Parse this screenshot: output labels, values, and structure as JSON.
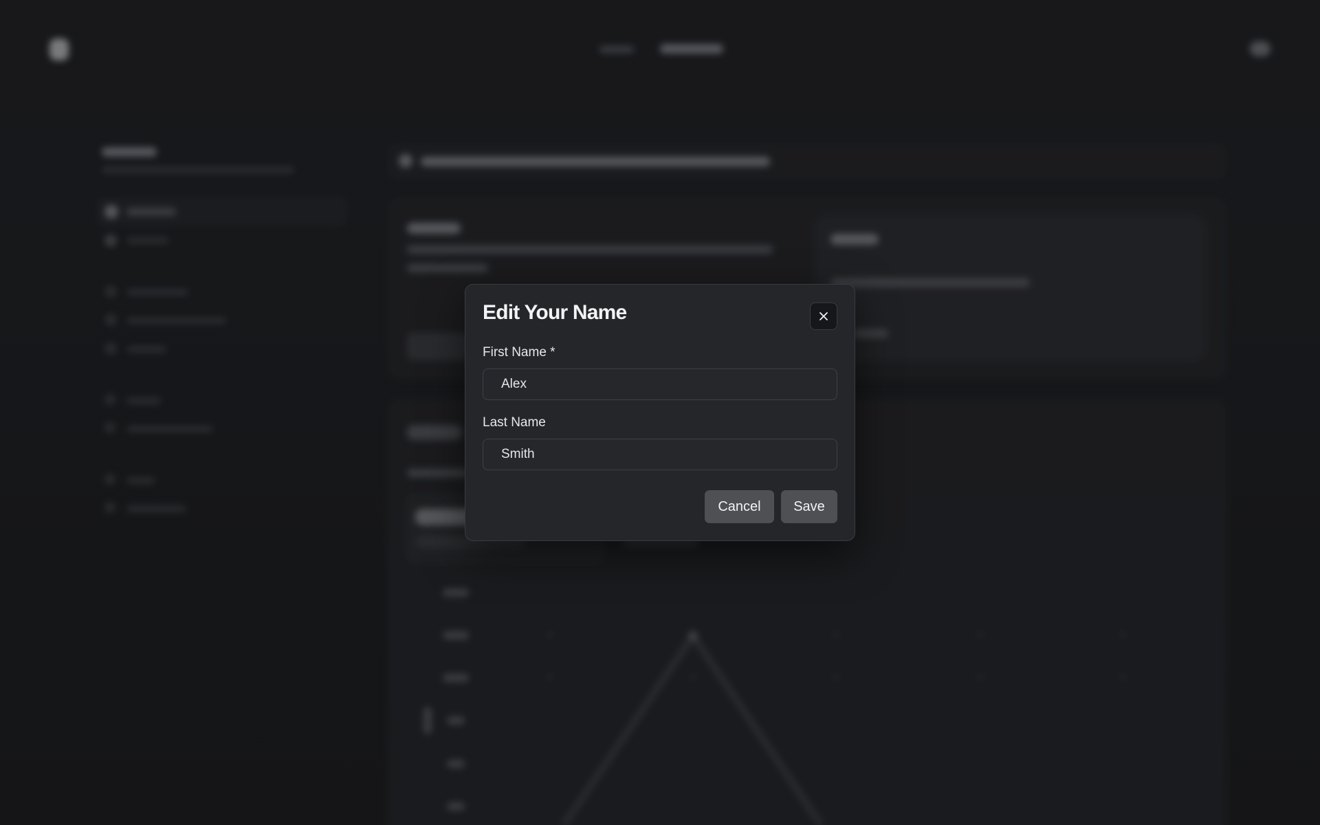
{
  "modal": {
    "title": "Edit Your Name",
    "close_icon": "close-icon",
    "first_name": {
      "label": "First Name *",
      "value": "Alex",
      "placeholder": ""
    },
    "last_name": {
      "label": "Last Name",
      "value": "Smith",
      "placeholder": ""
    },
    "buttons": {
      "cancel_label": "Cancel",
      "save_label": "Save"
    }
  },
  "colors": {
    "background": "#1a1b1e",
    "modal_bg": "#25262a",
    "button_bg": "#4f5054",
    "text": "#f3f3f5"
  }
}
